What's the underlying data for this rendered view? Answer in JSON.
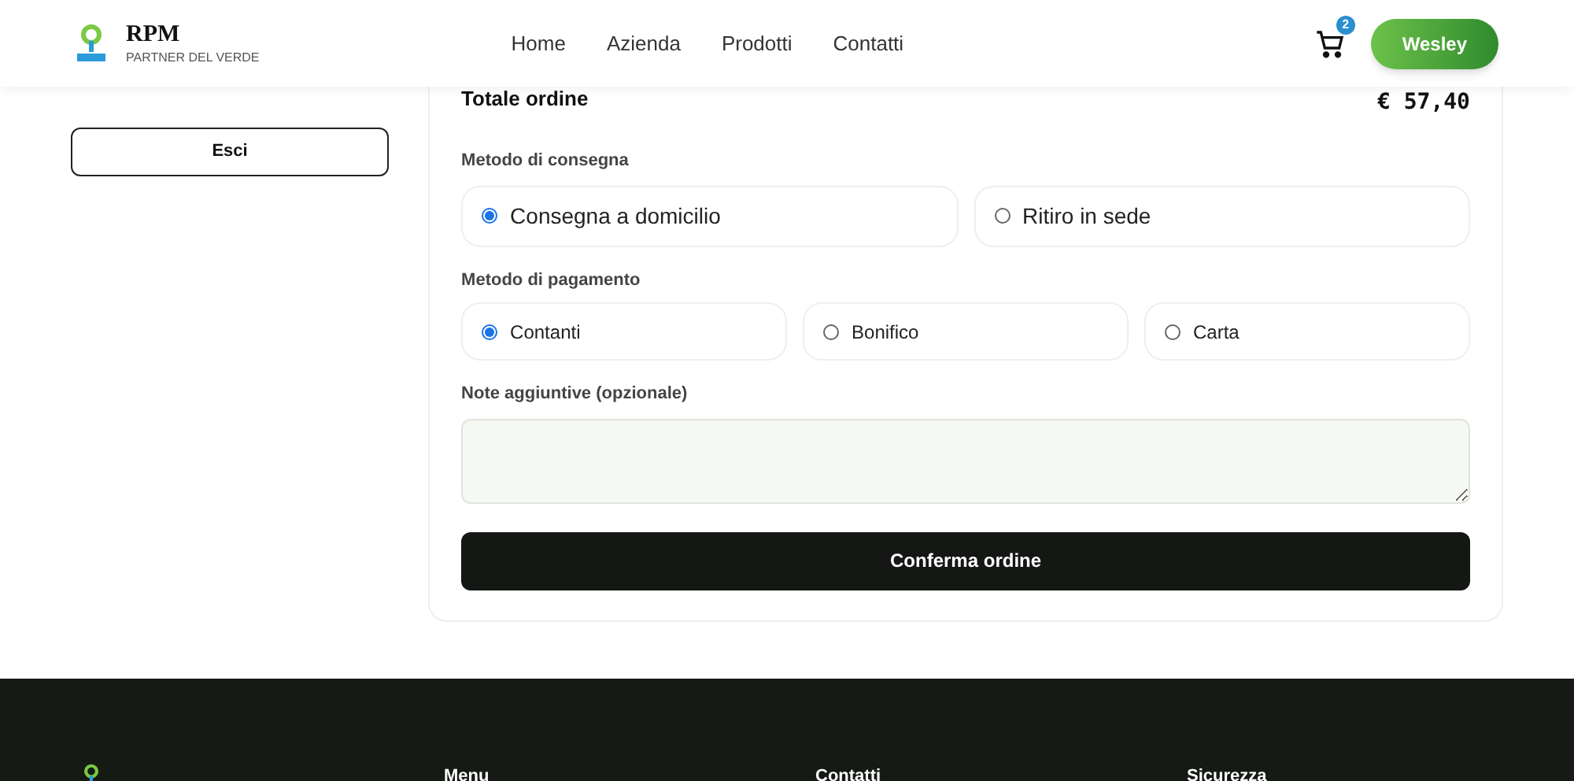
{
  "header": {
    "brand": "RPM",
    "tagline": "PARTNER DEL VERDE",
    "nav": [
      {
        "label": "Home"
      },
      {
        "label": "Azienda"
      },
      {
        "label": "Prodotti"
      },
      {
        "label": "Contatti"
      }
    ],
    "cart_count": "2",
    "user": "Wesley"
  },
  "sidebar": {
    "logout": "Esci"
  },
  "order": {
    "total_label": "Totale ordine",
    "total": "€ 57,40",
    "delivery_label": "Metodo di consegna",
    "delivery": [
      {
        "label": "Consegna a domicilio",
        "selected": true
      },
      {
        "label": "Ritiro in sede",
        "selected": false
      }
    ],
    "payment_label": "Metodo di pagamento",
    "payment": [
      {
        "label": "Contanti",
        "selected": true
      },
      {
        "label": "Bonifico",
        "selected": false
      },
      {
        "label": "Carta",
        "selected": false
      }
    ],
    "notes_label": "Note aggiuntive (opzionale)",
    "confirm": "Conferma ordine"
  },
  "footer": {
    "columns": [
      {
        "title": "Menu"
      },
      {
        "title": "Contatti"
      },
      {
        "title": "Sicurezza"
      }
    ]
  }
}
